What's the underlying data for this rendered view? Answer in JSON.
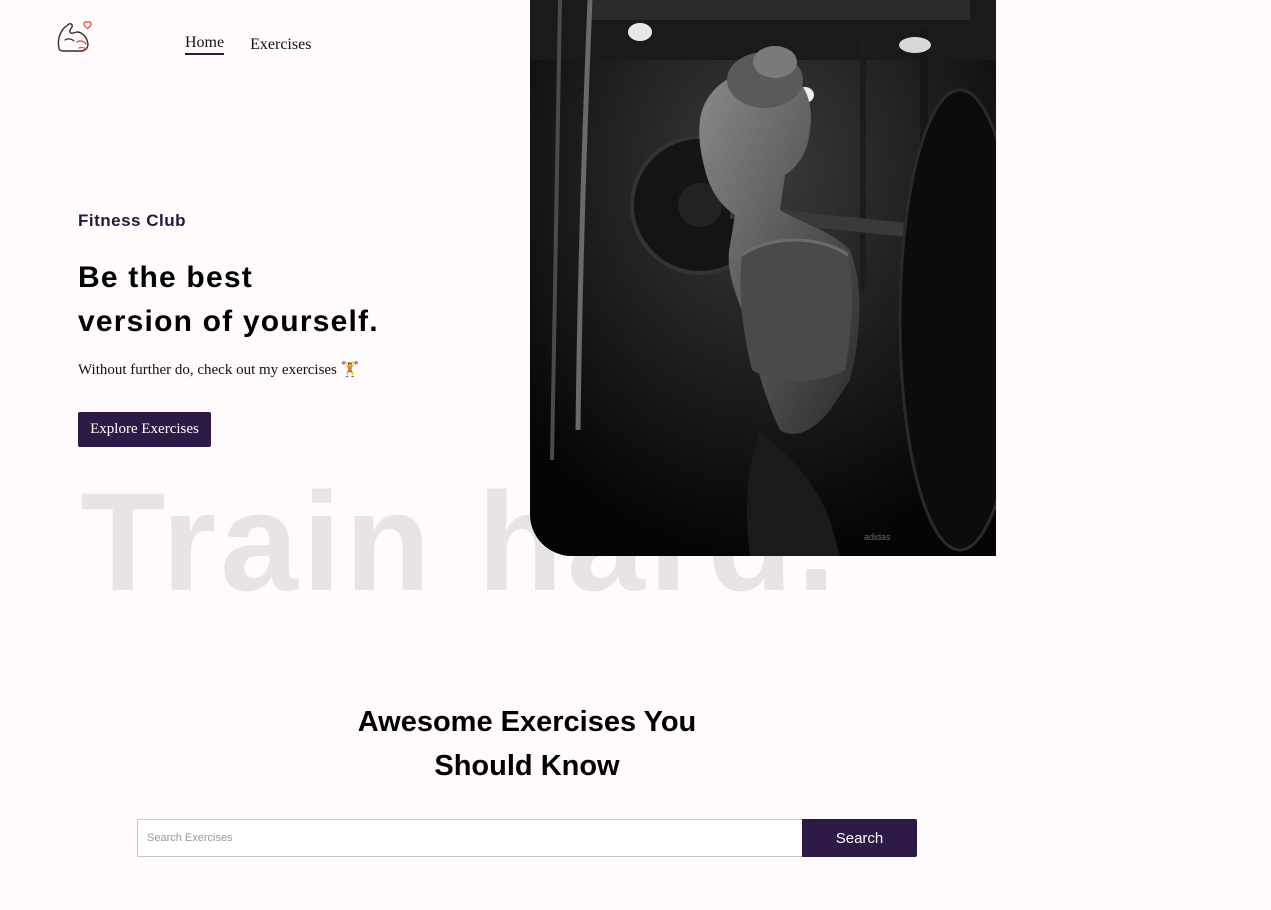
{
  "navbar": {
    "logo_icon": "flexed-arm-heart-icon",
    "links": [
      {
        "label": "Home",
        "active": true
      },
      {
        "label": "Exercises",
        "active": false
      }
    ]
  },
  "hero": {
    "subtitle": "Fitness Club",
    "title_line1": "Be the best",
    "title_line2": "version of yourself.",
    "description": "Without further do, check out my exercises 🏋️",
    "button_label": "Explore Exercises",
    "background_text": "Train hard."
  },
  "exercises_section": {
    "title_line1": "Awesome Exercises You",
    "title_line2": "Should Know",
    "search": {
      "placeholder": "Search Exercises",
      "value": "",
      "button_label": "Search"
    }
  },
  "colors": {
    "background": "#fffafb",
    "primary": "#2e1a47",
    "background_text": "#e8e3e6"
  }
}
